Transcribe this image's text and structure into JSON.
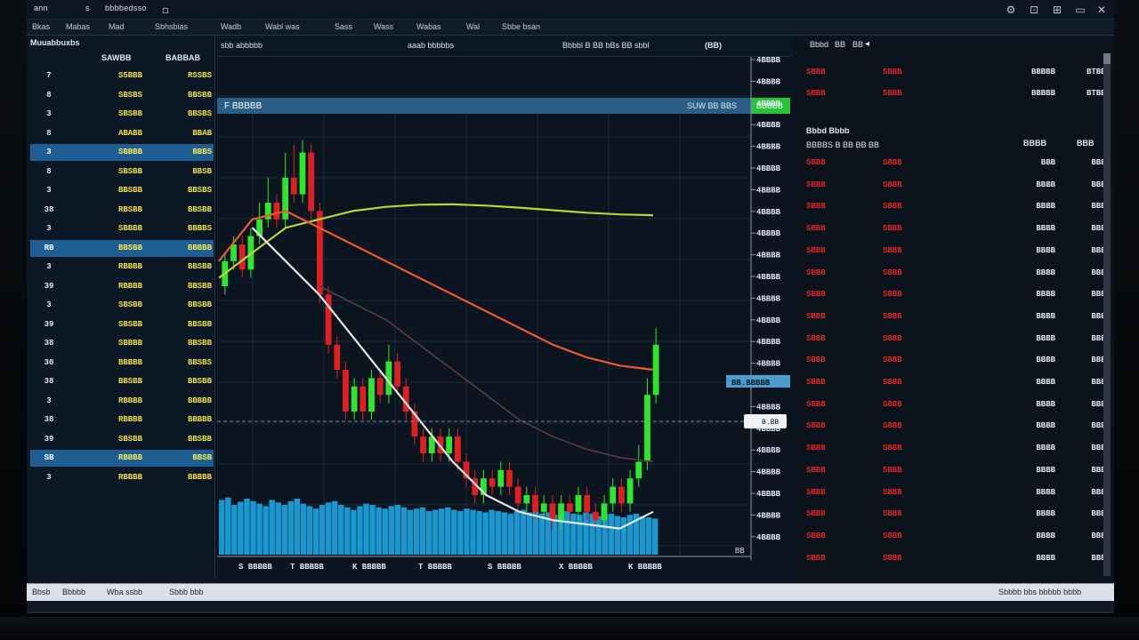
{
  "titlebar": {
    "left_label": "ann",
    "sep": "s",
    "title": "bbbbedsso",
    "window_icons": [
      "B",
      "Z",
      "S"
    ]
  },
  "menu": [
    "Bkas",
    "Mabas",
    "Mad",
    "Sbhsbias",
    "Wadb",
    "Wabl was",
    "Sass",
    "Wass",
    "Wabas",
    "Wal",
    "Sbbe bsan"
  ],
  "watchlist": {
    "title": "Muuabbuxbs",
    "col_a": "SAWBB",
    "col_b": "BABBAB",
    "rows": [
      {
        "sym": "7",
        "a": "S5BBB",
        "b": "RSSBS",
        "sel": false
      },
      {
        "sym": "8",
        "a": "SBSBS",
        "b": "BBSBB",
        "sel": false
      },
      {
        "sym": "3",
        "a": "SBSBB",
        "b": "BBSBS",
        "sel": false
      },
      {
        "sym": "8",
        "a": "ABABB",
        "b": "BBAB",
        "sel": false
      },
      {
        "sym": "3",
        "a": "SBBBB",
        "b": "BBBS",
        "sel": true
      },
      {
        "sym": "8",
        "a": "SBSBB",
        "b": "BBSB",
        "sel": false
      },
      {
        "sym": "3",
        "a": "BBSBB",
        "b": "BBSBS",
        "sel": false
      },
      {
        "sym": "38",
        "a": "RBSBB",
        "b": "BBSBB",
        "sel": false
      },
      {
        "sym": "3",
        "a": "SBBBB",
        "b": "BBBBS",
        "sel": false
      },
      {
        "sym": "RB",
        "a": "BBSBB",
        "b": "BBBBB",
        "sel": true
      },
      {
        "sym": "3",
        "a": "RBBBB",
        "b": "BBSBB",
        "sel": false
      },
      {
        "sym": "39",
        "a": "RBBBB",
        "b": "BBSBB",
        "sel": false
      },
      {
        "sym": "3",
        "a": "SBSBB",
        "b": "BBSBB",
        "sel": false
      },
      {
        "sym": "39",
        "a": "SBSBB",
        "b": "BBSBB",
        "sel": false
      },
      {
        "sym": "38",
        "a": "SBBBB",
        "b": "BBSBB",
        "sel": false
      },
      {
        "sym": "30",
        "a": "BBBBB",
        "b": "BBSBS",
        "sel": false
      },
      {
        "sym": "38",
        "a": "BBSBB",
        "b": "BBSBB",
        "sel": false
      },
      {
        "sym": "3",
        "a": "RBBBB",
        "b": "BBBBB",
        "sel": false
      },
      {
        "sym": "38",
        "a": "RBBBB",
        "b": "BBBBB",
        "sel": false
      },
      {
        "sym": "39",
        "a": "SBSBB",
        "b": "BBSBB",
        "sel": false
      },
      {
        "sym": "SB",
        "a": "RBBBB",
        "b": "BBSB",
        "sel": true
      },
      {
        "sym": "3",
        "a": "RBBBB",
        "b": "BBBBB",
        "sel": false
      }
    ]
  },
  "chart": {
    "toolbar_left": "sbb abbbbb",
    "toolbar_mid": "aaab bbbbbs",
    "toolbar_right": "Bbbbl  B  BB  bBs  BB  sbbl",
    "toolbar_icon": "(BB)",
    "symbol_label": "F BBBBB",
    "header_right": "SUW BB BBS",
    "header_badge": "BBBBB",
    "price_tag": "BB.BBBBB",
    "last_tag": "B.BB",
    "corner_label": "BB",
    "y_ticks": [
      "4BBBB",
      "4BBBB",
      "4BBBB",
      "4BBBB",
      "4BBBB",
      "4BBBB",
      "4BBBB",
      "4BBBB",
      "4BBBB",
      "4BBBB",
      "4BBBB",
      "4BBBB",
      "4BBBB",
      "4BBBB",
      "4BBBB",
      "4BBBB",
      "4BBBB",
      "4BBBB",
      "4BBBB",
      "4BBBB",
      "4BBBB",
      "4BBBB",
      "4BBBB"
    ],
    "x_ticks": [
      "S BBBBB",
      "T BBBBB",
      "K BBBBB",
      "T BBBBB",
      "S BBBBB",
      "X BBBBB",
      "K BBBBB"
    ]
  },
  "chart_data": {
    "type": "line",
    "title": "",
    "xlabel": "",
    "ylabel": "",
    "ylim": [
      0,
      100
    ],
    "candles": [
      {
        "o": 60,
        "c": 66,
        "h": 68,
        "l": 58
      },
      {
        "o": 66,
        "c": 70,
        "h": 72,
        "l": 64
      },
      {
        "o": 70,
        "c": 64,
        "h": 72,
        "l": 62
      },
      {
        "o": 64,
        "c": 72,
        "h": 74,
        "l": 62
      },
      {
        "o": 72,
        "c": 76,
        "h": 80,
        "l": 70
      },
      {
        "o": 76,
        "c": 80,
        "h": 86,
        "l": 74
      },
      {
        "o": 80,
        "c": 76,
        "h": 82,
        "l": 74
      },
      {
        "o": 76,
        "c": 86,
        "h": 92,
        "l": 74
      },
      {
        "o": 86,
        "c": 82,
        "h": 94,
        "l": 80
      },
      {
        "o": 82,
        "c": 92,
        "h": 95,
        "l": 80
      },
      {
        "o": 92,
        "c": 78,
        "h": 94,
        "l": 76
      },
      {
        "o": 78,
        "c": 58,
        "h": 80,
        "l": 56
      },
      {
        "o": 58,
        "c": 46,
        "h": 60,
        "l": 44
      },
      {
        "o": 46,
        "c": 40,
        "h": 48,
        "l": 38
      },
      {
        "o": 40,
        "c": 30,
        "h": 42,
        "l": 28
      },
      {
        "o": 30,
        "c": 36,
        "h": 38,
        "l": 28
      },
      {
        "o": 36,
        "c": 30,
        "h": 38,
        "l": 28
      },
      {
        "o": 30,
        "c": 38,
        "h": 40,
        "l": 28
      },
      {
        "o": 38,
        "c": 34,
        "h": 40,
        "l": 32
      },
      {
        "o": 34,
        "c": 42,
        "h": 46,
        "l": 32
      },
      {
        "o": 42,
        "c": 36,
        "h": 44,
        "l": 34
      },
      {
        "o": 36,
        "c": 30,
        "h": 38,
        "l": 28
      },
      {
        "o": 30,
        "c": 24,
        "h": 32,
        "l": 22
      },
      {
        "o": 24,
        "c": 20,
        "h": 26,
        "l": 18
      },
      {
        "o": 20,
        "c": 24,
        "h": 26,
        "l": 18
      },
      {
        "o": 24,
        "c": 20,
        "h": 26,
        "l": 18
      },
      {
        "o": 20,
        "c": 24,
        "h": 26,
        "l": 18
      },
      {
        "o": 24,
        "c": 18,
        "h": 26,
        "l": 16
      },
      {
        "o": 18,
        "c": 14,
        "h": 20,
        "l": 12
      },
      {
        "o": 14,
        "c": 10,
        "h": 16,
        "l": 8
      },
      {
        "o": 10,
        "c": 14,
        "h": 16,
        "l": 8
      },
      {
        "o": 14,
        "c": 12,
        "h": 16,
        "l": 10
      },
      {
        "o": 12,
        "c": 16,
        "h": 18,
        "l": 10
      },
      {
        "o": 16,
        "c": 12,
        "h": 18,
        "l": 10
      },
      {
        "o": 12,
        "c": 8,
        "h": 14,
        "l": 6
      },
      {
        "o": 8,
        "c": 10,
        "h": 12,
        "l": 6
      },
      {
        "o": 10,
        "c": 6,
        "h": 12,
        "l": 4
      },
      {
        "o": 6,
        "c": 8,
        "h": 10,
        "l": 4
      },
      {
        "o": 8,
        "c": 4,
        "h": 10,
        "l": 2
      },
      {
        "o": 4,
        "c": 8,
        "h": 10,
        "l": 2
      },
      {
        "o": 8,
        "c": 6,
        "h": 10,
        "l": 4
      },
      {
        "o": 6,
        "c": 10,
        "h": 12,
        "l": 4
      },
      {
        "o": 10,
        "c": 6,
        "h": 12,
        "l": 4
      },
      {
        "o": 6,
        "c": 4,
        "h": 8,
        "l": 2
      },
      {
        "o": 4,
        "c": 8,
        "h": 10,
        "l": 2
      },
      {
        "o": 8,
        "c": 12,
        "h": 14,
        "l": 6
      },
      {
        "o": 12,
        "c": 8,
        "h": 14,
        "l": 6
      },
      {
        "o": 8,
        "c": 14,
        "h": 16,
        "l": 6
      },
      {
        "o": 14,
        "c": 18,
        "h": 22,
        "l": 12
      },
      {
        "o": 18,
        "c": 34,
        "h": 38,
        "l": 16
      },
      {
        "o": 34,
        "c": 46,
        "h": 50,
        "l": 32
      }
    ],
    "series": [
      {
        "color": "#b8d63a",
        "values": [
          62,
          68,
          74,
          76,
          78,
          79,
          79.5,
          79.6,
          79.3,
          78.8,
          78.2,
          77.6,
          77.2,
          77
        ]
      },
      {
        "color": "#ee5a2c",
        "values": [
          66,
          76,
          78,
          74,
          70,
          66,
          62,
          58,
          54,
          50,
          46,
          43,
          41,
          40
        ]
      },
      {
        "color": "#5a3c44",
        "values": [
          null,
          null,
          null,
          60,
          56,
          52,
          46,
          40,
          34,
          28,
          24,
          21,
          19,
          18
        ]
      },
      {
        "color": "#e8e8e8",
        "values": [
          null,
          74,
          66,
          58,
          48,
          38,
          28,
          18,
          10,
          6,
          4,
          3,
          2,
          6
        ]
      }
    ],
    "volume": [
      88,
      92,
      80,
      85,
      90,
      86,
      82,
      78,
      88,
      84,
      80,
      86,
      90,
      82,
      78,
      74,
      80,
      84,
      86,
      80,
      76,
      72,
      78,
      82,
      80,
      76,
      74,
      78,
      80,
      76,
      72,
      74,
      76,
      70,
      72,
      74,
      76,
      72,
      70,
      74,
      72,
      70,
      68,
      72,
      70,
      68,
      66,
      70,
      72,
      68,
      70,
      66,
      68,
      64,
      66,
      70,
      66,
      64,
      68,
      66,
      62,
      64,
      66,
      62,
      60,
      64,
      66,
      62,
      60,
      58
    ]
  },
  "orderbook": {
    "header_labels": [
      "Bbbd",
      "BB",
      "BB"
    ],
    "top": [
      {
        "p": "SBBB",
        "q": "SBBB",
        "s": "BBBBB",
        "t": "BTBBB"
      },
      {
        "p": "SBBB",
        "q": "SBBB",
        "s": "BBBBB",
        "t": "BTBBB"
      }
    ],
    "info_title": "Bbbd Bbbb",
    "info_sub": "BBBBS B BB  BB  BB",
    "col_s": "BBBB",
    "col_t": "BBB",
    "rows": [
      {
        "p": "SBBB",
        "q": "SBBB",
        "s": "BBB",
        "t": "BBBB"
      },
      {
        "p": "SBBB",
        "q": "SBBB",
        "s": "BBBB",
        "t": "BBBB"
      },
      {
        "p": "SBBB",
        "q": "SBBB",
        "s": "BBBB",
        "t": "BBBB"
      },
      {
        "p": "SBBB",
        "q": "SBBB",
        "s": "BBBB",
        "t": "BBBB"
      },
      {
        "p": "SBBB",
        "q": "SBBB",
        "s": "BBBB",
        "t": "BBBB"
      },
      {
        "p": "SBBB",
        "q": "SBBB",
        "s": "BBBB",
        "t": "BBBB"
      },
      {
        "p": "SBBB",
        "q": "SBBB",
        "s": "BBBB",
        "t": "BBBB"
      },
      {
        "p": "SBBB",
        "q": "SBBB",
        "s": "BBBB",
        "t": "BBBB"
      },
      {
        "p": "SBBB",
        "q": "SBBB",
        "s": "BBBB",
        "t": "BBBB"
      },
      {
        "p": "SBBB",
        "q": "SBBB",
        "s": "BBBB",
        "t": "BBBB"
      },
      {
        "p": "SBBB",
        "q": "SBBB",
        "s": "BBBB",
        "t": "BBBB"
      },
      {
        "p": "SBBB",
        "q": "SBBB",
        "s": "BBBB",
        "t": "BBBB"
      },
      {
        "p": "SBBB",
        "q": "SBBB",
        "s": "BBBB",
        "t": "BBBB"
      },
      {
        "p": "SBBB",
        "q": "SBBB",
        "s": "BBBB",
        "t": "BBBB"
      },
      {
        "p": "SBBB",
        "q": "SBBB",
        "s": "BBBB",
        "t": "BBBB"
      },
      {
        "p": "SBBB",
        "q": "SBBB",
        "s": "BBBB",
        "t": "BBBB"
      },
      {
        "p": "SBBB",
        "q": "SBBB",
        "s": "BBBB",
        "t": "BBBB"
      },
      {
        "p": "SBBB",
        "q": "SBBB",
        "s": "BBBB",
        "t": "BBBB"
      },
      {
        "p": "SBBB",
        "q": "SBBB",
        "s": "BBBB",
        "t": "BBBB"
      }
    ]
  },
  "statusbar": {
    "left": [
      "Bbsb",
      "Bbbbb",
      "Wba ssbb",
      "Sbbb bbb"
    ],
    "right": "Sbbbb bbs bbbbb bbbb"
  },
  "colors": {
    "bg": "#0a1520",
    "up": "#2ee62e",
    "down": "#e02020",
    "volume": "#1aa3e0",
    "selected": "#1e5e93",
    "ask_text": "#e02525",
    "watch_text": "#f0e040"
  }
}
